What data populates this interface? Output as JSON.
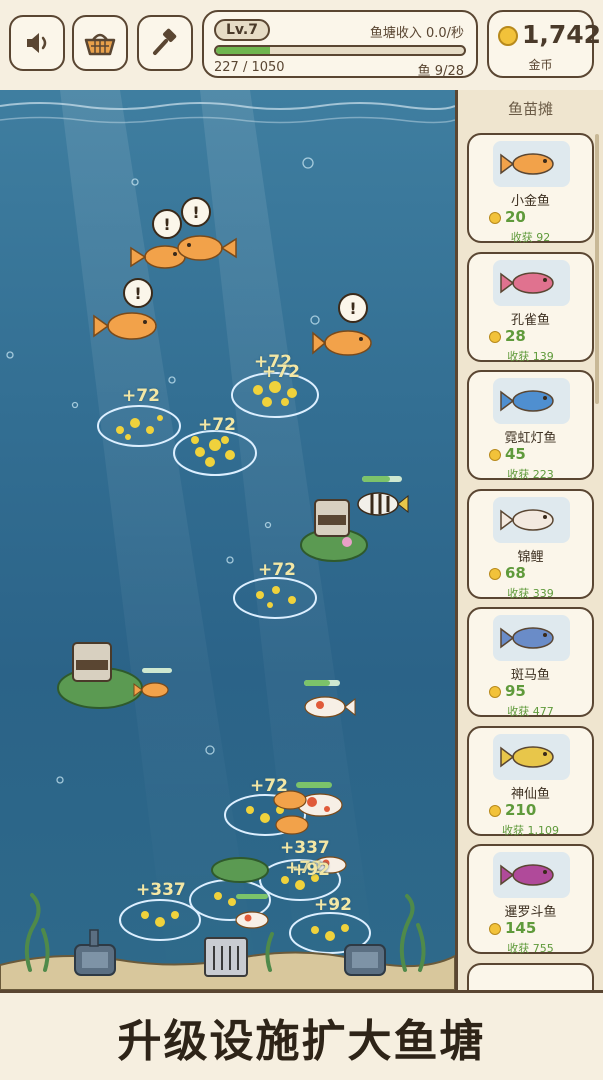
{
  "hud": {
    "sound_icon": "speaker-icon",
    "basket_icon": "basket-icon",
    "hammer_icon": "hammer-icon",
    "level": "Lv.7",
    "income": "鱼塘收入 0.0/秒",
    "xp_text": "227 / 1050",
    "xp_progress": 0.216,
    "fish_count": "鱼 9/28",
    "coins": "1,742",
    "coins_label": "金币"
  },
  "pond": {
    "coin_piles": [
      "+72",
      "+72",
      "+72",
      "+72",
      "+72",
      "+72",
      "+337",
      "+337",
      "+72",
      "+92",
      "+92"
    ]
  },
  "shop": {
    "title": "鱼苗摊",
    "items": [
      {
        "name": "小金鱼",
        "price": "20",
        "harvest": "收获 92",
        "color": "#f2a24a"
      },
      {
        "name": "孔雀鱼",
        "price": "28",
        "harvest": "收获 139",
        "color": "#e0728f"
      },
      {
        "name": "霓虹灯鱼",
        "price": "45",
        "harvest": "收获 223",
        "color": "#4f8fd0"
      },
      {
        "name": "锦鲤",
        "price": "68",
        "harvest": "收获 339",
        "color": "#f3e9df"
      },
      {
        "name": "斑马鱼",
        "price": "95",
        "harvest": "收获 477",
        "color": "#6a8cc8"
      },
      {
        "name": "神仙鱼",
        "price": "210",
        "harvest": "收获 1,109",
        "color": "#e8c64a"
      },
      {
        "name": "暹罗斗鱼",
        "price": "145",
        "harvest": "收获 755",
        "color": "#b04a9a"
      }
    ]
  },
  "banner": {
    "text": "升级设施扩大鱼塘"
  },
  "colors": {
    "outline": "#5a4632",
    "water": "#336f93",
    "xp_green": "#6fb64f",
    "price_green": "#5f9a3b",
    "coin_gold": "#f2c23a"
  }
}
